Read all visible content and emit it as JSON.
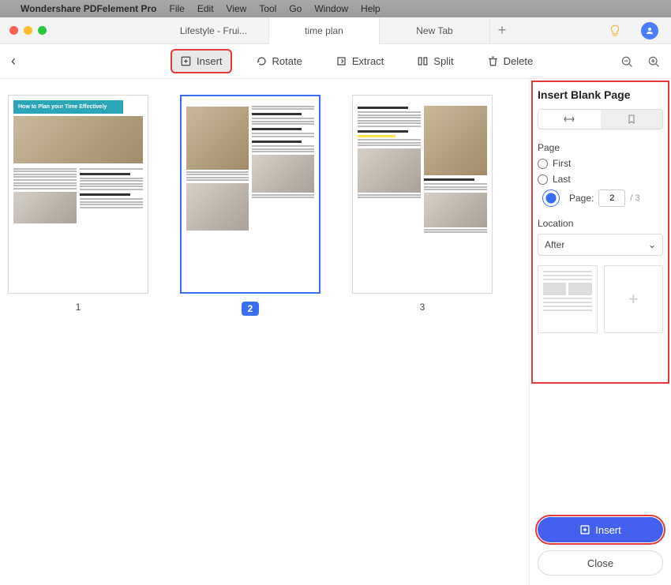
{
  "menubar": {
    "appname": "Wondershare PDFelement Pro",
    "menus": [
      "File",
      "Edit",
      "View",
      "Tool",
      "Go",
      "Window",
      "Help"
    ]
  },
  "tabs": {
    "items": [
      {
        "label": "Lifestyle - Frui..."
      },
      {
        "label": "time plan"
      },
      {
        "label": "New Tab"
      }
    ],
    "active_index": 1,
    "newtab": "+"
  },
  "toolbar": {
    "back": "‹",
    "insert": "Insert",
    "rotate": "Rotate",
    "extract": "Extract",
    "split": "Split",
    "delete": "Delete"
  },
  "pages": {
    "banner_text": "How to Plan your Time Effectively",
    "labels": [
      "1",
      "2",
      "3"
    ],
    "selected_index": 1
  },
  "side": {
    "title": "Insert Blank Page",
    "page_label": "Page",
    "opt_first": "First",
    "opt_last": "Last",
    "opt_page": "Page:",
    "page_value": "2",
    "page_total": "/  3",
    "location_label": "Location",
    "location_value": "After",
    "insert_btn": "Insert",
    "close_btn": "Close"
  }
}
